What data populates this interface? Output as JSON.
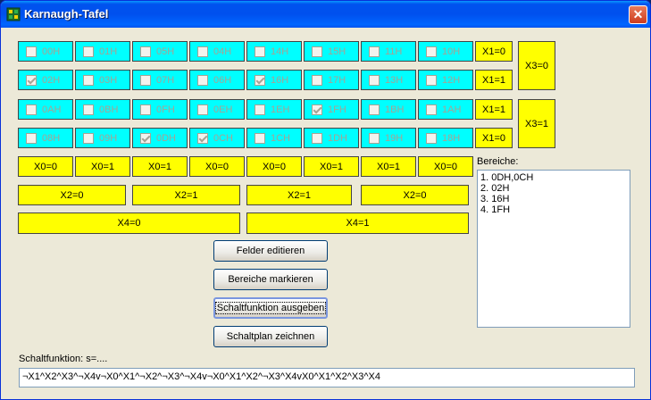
{
  "window": {
    "title": "Karnaugh-Tafel",
    "close_glyph": "✕"
  },
  "grid": {
    "rows": [
      [
        {
          "label": "00H",
          "checked": false
        },
        {
          "label": "01H",
          "checked": false
        },
        {
          "label": "05H",
          "checked": false
        },
        {
          "label": "04H",
          "checked": false
        },
        {
          "label": "14H",
          "checked": false
        },
        {
          "label": "15H",
          "checked": false
        },
        {
          "label": "11H",
          "checked": false
        },
        {
          "label": "10H",
          "checked": false
        }
      ],
      [
        {
          "label": "02H",
          "checked": true
        },
        {
          "label": "03H",
          "checked": false
        },
        {
          "label": "07H",
          "checked": false
        },
        {
          "label": "06H",
          "checked": false
        },
        {
          "label": "16H",
          "checked": true
        },
        {
          "label": "17H",
          "checked": false
        },
        {
          "label": "13H",
          "checked": false
        },
        {
          "label": "12H",
          "checked": false
        }
      ],
      [
        {
          "label": "0AH",
          "checked": false
        },
        {
          "label": "0BH",
          "checked": false
        },
        {
          "label": "0FH",
          "checked": false
        },
        {
          "label": "0EH",
          "checked": false
        },
        {
          "label": "1EH",
          "checked": false
        },
        {
          "label": "1FH",
          "checked": true
        },
        {
          "label": "1BH",
          "checked": false
        },
        {
          "label": "1AH",
          "checked": false
        }
      ],
      [
        {
          "label": "08H",
          "checked": false
        },
        {
          "label": "09H",
          "checked": false
        },
        {
          "label": "0DH",
          "checked": true
        },
        {
          "label": "0CH",
          "checked": true
        },
        {
          "label": "1CH",
          "checked": false
        },
        {
          "label": "1DH",
          "checked": false
        },
        {
          "label": "19H",
          "checked": false
        },
        {
          "label": "18H",
          "checked": false
        }
      ]
    ],
    "x1_labels": [
      "X1=0",
      "X1=1",
      "X1=1",
      "X1=0"
    ],
    "x3_labels": [
      "X3=0",
      "X3=1"
    ],
    "x0_labels": [
      "X0=0",
      "X0=1",
      "X0=1",
      "X0=0",
      "X0=0",
      "X0=1",
      "X0=1",
      "X0=0"
    ],
    "x2_labels": [
      "X2=0",
      "X2=1",
      "X2=1",
      "X2=0"
    ],
    "x4_labels": [
      "X4=0",
      "X4=1"
    ]
  },
  "buttons": {
    "edit_fields": "Felder editieren",
    "mark_areas": "Bereiche markieren",
    "output_function": "Schaltfunktion ausgeben",
    "draw_plan": "Schaltplan zeichnen"
  },
  "areas": {
    "label": "Bereiche:",
    "items": [
      "1. 0DH,0CH",
      "2. 02H",
      "3. 16H",
      "4. 1FH"
    ]
  },
  "function": {
    "label": "Schaltfunktion: s=....",
    "value": "¬X1^X2^X3^¬X4v¬X0^X1^¬X2^¬X3^¬X4v¬X0^X1^X2^¬X3^X4vX0^X1^X2^X3^X4"
  }
}
